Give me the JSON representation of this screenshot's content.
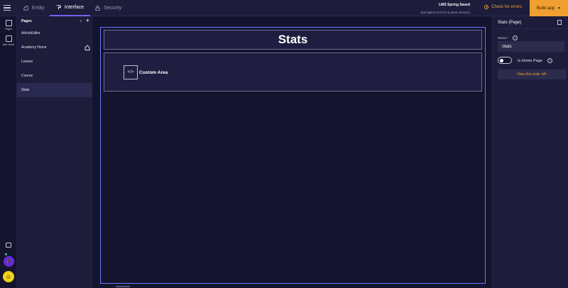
{
  "topbar": {
    "tabs": [
      {
        "label": "Entity",
        "icon": "entity-icon"
      },
      {
        "label": "Interface",
        "icon": "interface-icon",
        "active": true
      },
      {
        "label": "Security",
        "icon": "lock-icon"
      }
    ],
    "project_title": "LMS Spring Saved",
    "project_version": "SpringBot v2.0.0.0     (Latest Version)",
    "check_errors": "Check for errors",
    "build_app": "Build app"
  },
  "rail": {
    "pages_label": "Pages",
    "add_views_label": "Add Views"
  },
  "pages_panel": {
    "title": "Pages",
    "count": "5",
    "add_symbol": "+",
    "items": [
      {
        "label": "ArticleEditor"
      },
      {
        "label": "Academy Home",
        "is_home": true
      },
      {
        "label": "Lesson"
      },
      {
        "label": "Course"
      },
      {
        "label": "Stats",
        "active": true
      }
    ]
  },
  "canvas": {
    "page_title": "Stats",
    "custom_area_label": "Custom Area",
    "code_glyph": "</>"
  },
  "properties": {
    "title": "Stats (Page)",
    "name_label": "Name *",
    "name_value": "Stats",
    "is_home_page_label": "Is Home Page",
    "is_home_page": false,
    "view_code_label": "View this code",
    "view_code_glyph": "</>"
  },
  "colors": {
    "accent_orange": "#f0a030",
    "frame_blue": "#6a78ff",
    "active_tab_underline": "#7b5cf0",
    "background": "#15142f"
  }
}
